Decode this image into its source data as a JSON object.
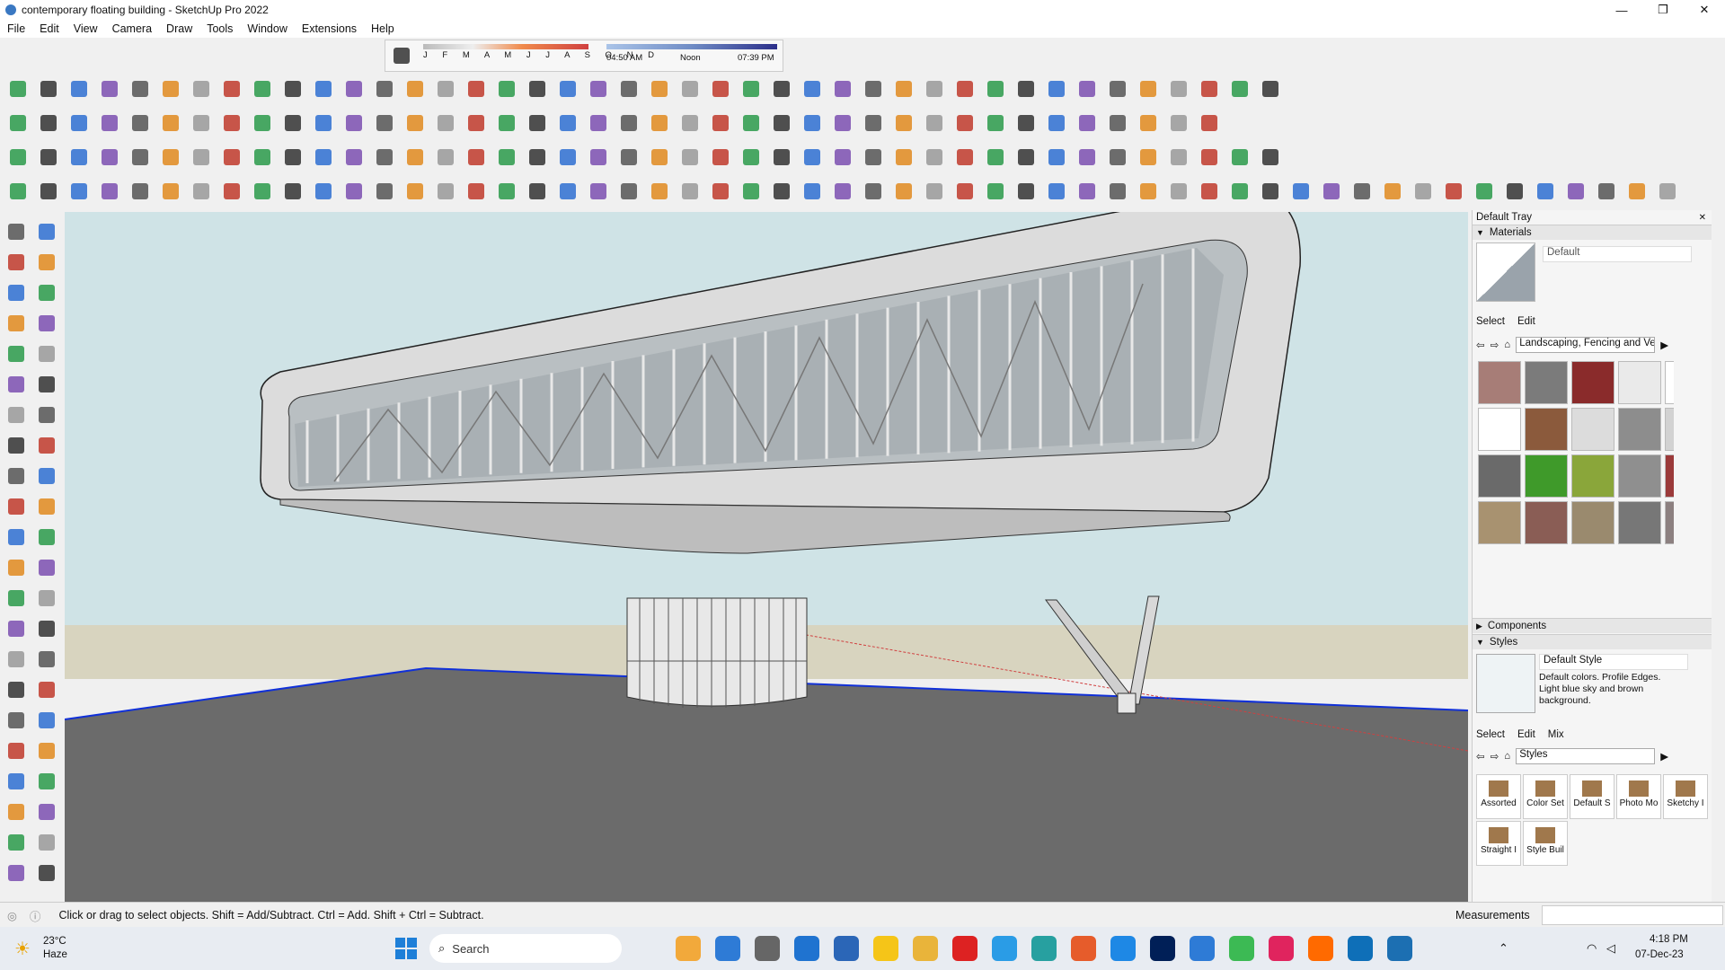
{
  "window": {
    "title": "contemporary floating building - SketchUp Pro 2022",
    "controls": [
      "—",
      "❐",
      "✕"
    ]
  },
  "menu": [
    "File",
    "Edit",
    "View",
    "Camera",
    "Draw",
    "Tools",
    "Window",
    "Extensions",
    "Help"
  ],
  "shadow_bar": {
    "months": "J F M A M J J A S O N D",
    "time_start": "04:50 AM",
    "time_mid": "Noon",
    "time_end": "07:39 PM"
  },
  "tray": {
    "title": "Default Tray",
    "materials": {
      "header": "Materials",
      "current": "Default",
      "tabs": [
        "Select",
        "Edit"
      ],
      "library": "Landscaping, Fencing and Ve",
      "swatch_colors": [
        "#a77d77",
        "#7b7b7b",
        "#8a2b2b",
        "#eaeaea",
        "#ffffff",
        "#ffffff",
        "#8b5a3c",
        "#dcdcdc",
        "#8d8d8d",
        "#d2d2d2",
        "#6a6a6a",
        "#3f9a2a",
        "#8aa63a",
        "#8f8f8f",
        "#9b3a3a",
        "#a89270",
        "#8a5d55",
        "#9a8a6e",
        "#777777",
        "#8c8080"
      ]
    },
    "components": {
      "header": "Components"
    },
    "styles": {
      "header": "Styles",
      "name": "Default Style",
      "description": "Default colors. Profile Edges. Light blue sky and brown background.",
      "tabs": [
        "Select",
        "Edit",
        "Mix"
      ],
      "library": "Styles",
      "folders": [
        "Assorted",
        "Color Set",
        "Default S",
        "Photo Mo",
        "Sketchy I",
        "Straight I",
        "Style Buil"
      ]
    }
  },
  "status": {
    "hint": "Click or drag to select objects. Shift = Add/Subtract. Ctrl = Add. Shift + Ctrl = Subtract.",
    "measurements_label": "Measurements"
  },
  "taskbar": {
    "weather_temp": "23°C",
    "weather_text": "Haze",
    "search_placeholder": "Search",
    "time": "4:18 PM",
    "date": "07-Dec-23"
  },
  "colors": {
    "sky": "#cfe3e6",
    "ground": "#d8d4bf",
    "floor": "#6b6b6b",
    "axis_blue": "#1030d8",
    "axis_red": "#d04040"
  }
}
